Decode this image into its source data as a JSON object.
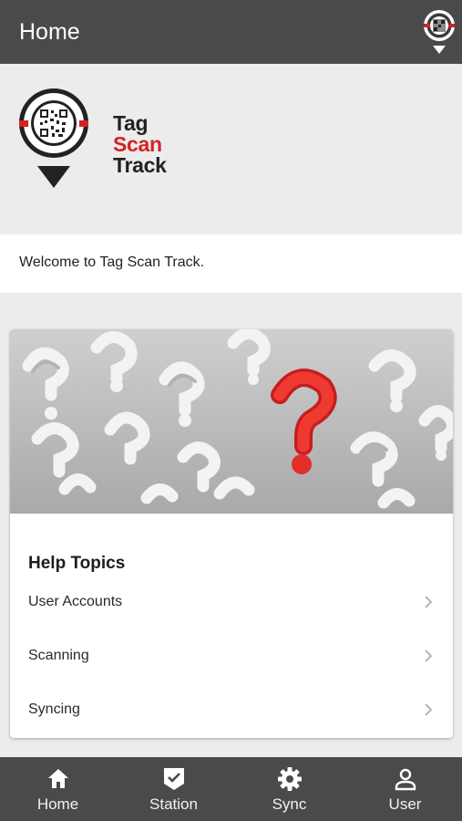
{
  "header": {
    "title": "Home",
    "logo_icon": "tag-scan-track-logo-icon"
  },
  "brand": {
    "line1": "Tag",
    "line2": "Scan",
    "line3": "Track",
    "accent_color": "#d62222"
  },
  "welcome": {
    "text": "Welcome to Tag Scan Track."
  },
  "help": {
    "image": "question-marks-image",
    "title": "Help Topics",
    "topics": [
      {
        "label": "User Accounts"
      },
      {
        "label": "Scanning"
      },
      {
        "label": "Syncing"
      }
    ]
  },
  "nav": {
    "items": [
      {
        "label": "Home",
        "icon": "home-icon"
      },
      {
        "label": "Station",
        "icon": "station-check-icon"
      },
      {
        "label": "Sync",
        "icon": "gear-icon"
      },
      {
        "label": "User",
        "icon": "user-icon"
      }
    ]
  },
  "colors": {
    "bar": "#4a4a4a",
    "background": "#ececec"
  }
}
